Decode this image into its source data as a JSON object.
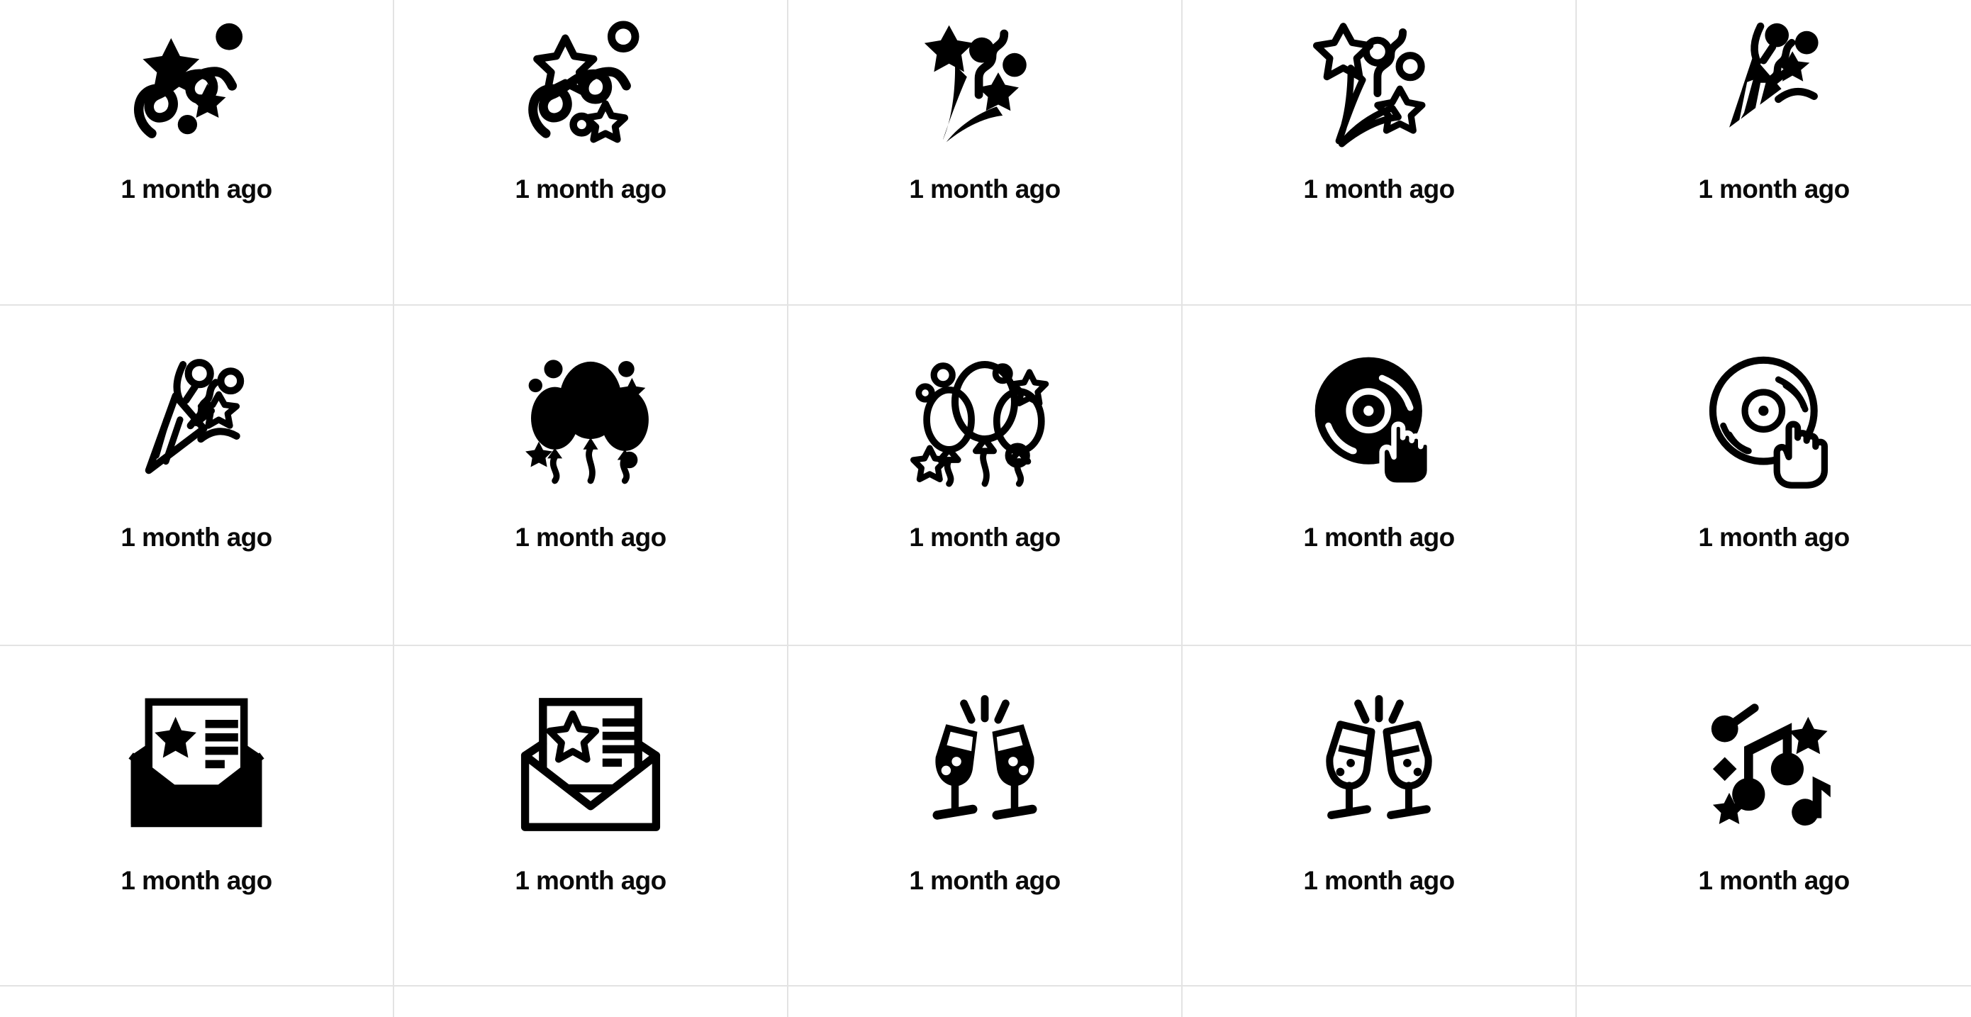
{
  "grid": {
    "columns": 5,
    "gridline_color": "#e3e3e3",
    "background_color": "#ffffff",
    "icon_color": "#000000",
    "caption_color": "#0a0a0a"
  },
  "rows": [
    {
      "row_label": "row-1",
      "cells": [
        {
          "icon_name": "confetti-streamers-filled-icon",
          "caption": "1 month ago"
        },
        {
          "icon_name": "confetti-streamers-outline-icon",
          "caption": "1 month ago"
        },
        {
          "icon_name": "firework-burst-filled-icon",
          "caption": "1 month ago"
        },
        {
          "icon_name": "firework-burst-outline-icon",
          "caption": "1 month ago"
        },
        {
          "icon_name": "party-popper-filled-icon",
          "caption": "1 month ago"
        }
      ]
    },
    {
      "row_label": "row-2",
      "cells": [
        {
          "icon_name": "party-popper-outline-icon",
          "caption": "1 month ago"
        },
        {
          "icon_name": "balloons-filled-icon",
          "caption": "1 month ago"
        },
        {
          "icon_name": "balloons-outline-icon",
          "caption": "1 month ago"
        },
        {
          "icon_name": "vinyl-record-dj-filled-icon",
          "caption": "1 month ago"
        },
        {
          "icon_name": "vinyl-record-dj-outline-icon",
          "caption": "1 month ago"
        }
      ]
    },
    {
      "row_label": "row-3",
      "cells": [
        {
          "icon_name": "invitation-envelope-filled-icon",
          "caption": "1 month ago"
        },
        {
          "icon_name": "invitation-envelope-outline-icon",
          "caption": "1 month ago"
        },
        {
          "icon_name": "champagne-cheers-filled-icon",
          "caption": "1 month ago"
        },
        {
          "icon_name": "champagne-cheers-outline-icon",
          "caption": "1 month ago"
        },
        {
          "icon_name": "music-notes-party-filled-icon",
          "caption": "1 month ago"
        }
      ]
    },
    {
      "row_label": "row-4",
      "cells": [
        {
          "icon_name": "clipped-icon-cell",
          "caption": ""
        },
        {
          "icon_name": "clipped-icon-cell",
          "caption": ""
        },
        {
          "icon_name": "clipped-icon-cell",
          "caption": ""
        },
        {
          "icon_name": "clipped-icon-cell",
          "caption": ""
        },
        {
          "icon_name": "clipped-icon-cell",
          "caption": ""
        }
      ]
    }
  ]
}
